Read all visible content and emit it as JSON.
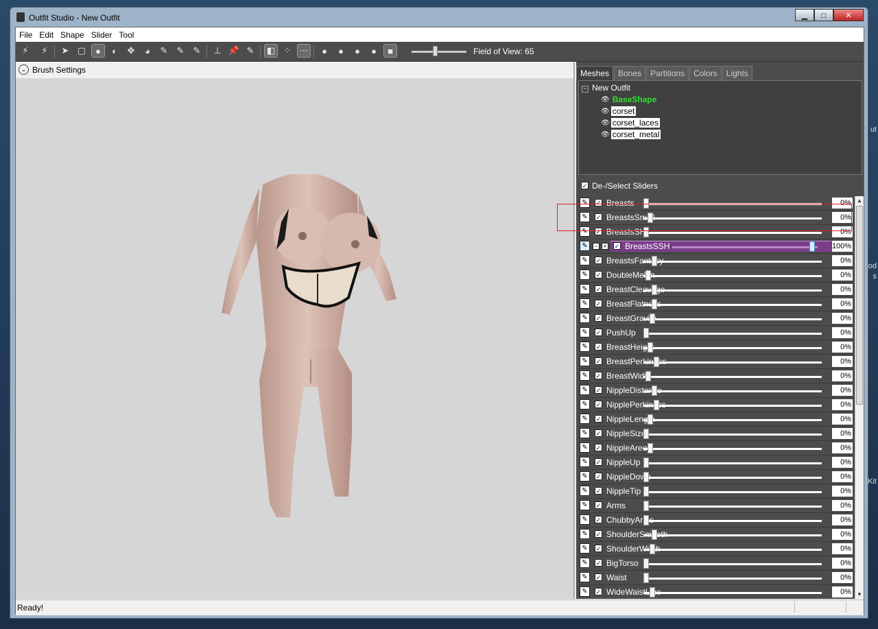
{
  "window": {
    "title": "Outfit Studio - New Outfit",
    "btn_min": "▁",
    "btn_max": "□",
    "btn_close": "✕"
  },
  "menu": [
    "File",
    "Edit",
    "Shape",
    "Slider",
    "Tool"
  ],
  "toolbar": {
    "fov_label": "Field of View: 65",
    "fov_value": 65
  },
  "left": {
    "brush_settings": "Brush Settings"
  },
  "tabs": [
    {
      "label": "Meshes",
      "active": true
    },
    {
      "label": "Bones",
      "active": false
    },
    {
      "label": "Partitions",
      "active": false
    },
    {
      "label": "Colors",
      "active": false
    },
    {
      "label": "Lights",
      "active": false
    }
  ],
  "tree": {
    "root": "New Outfit",
    "meshes": [
      {
        "name": "BaseShape",
        "selected": true
      },
      {
        "name": "corset",
        "selected": false
      },
      {
        "name": "corset_laces",
        "selected": false
      },
      {
        "name": "corset_metal",
        "selected": false
      }
    ]
  },
  "deselect_label": "De-/Select Sliders",
  "sliders": [
    {
      "name": "Breasts",
      "value": 0,
      "text": "0%"
    },
    {
      "name": "BreastsSmall",
      "value": 0,
      "text": "0%"
    },
    {
      "name": "BreastsSH",
      "value": 0,
      "text": "0%"
    },
    {
      "name": "BreastsSSH",
      "value": 100,
      "text": "100%",
      "editing": true
    },
    {
      "name": "BreastsFantasy",
      "value": 0,
      "text": "0%"
    },
    {
      "name": "DoubleMelon",
      "value": 0,
      "text": "0%"
    },
    {
      "name": "BreastCleavage",
      "value": 0,
      "text": "0%"
    },
    {
      "name": "BreastFlatness",
      "value": 0,
      "text": "0%"
    },
    {
      "name": "BreastGravity",
      "value": 0,
      "text": "0%"
    },
    {
      "name": "PushUp",
      "value": 0,
      "text": "0%"
    },
    {
      "name": "BreastHeight",
      "value": 0,
      "text": "0%"
    },
    {
      "name": "BreastPerkiness",
      "value": 0,
      "text": "0%"
    },
    {
      "name": "BreastWidth",
      "value": 0,
      "text": "0%"
    },
    {
      "name": "NippleDistance",
      "value": 0,
      "text": "0%"
    },
    {
      "name": "NipplePerkiness",
      "value": 0,
      "text": "0%"
    },
    {
      "name": "NippleLength",
      "value": 0,
      "text": "0%"
    },
    {
      "name": "NippleSize",
      "value": 0,
      "text": "0%"
    },
    {
      "name": "NippleAreola",
      "value": 0,
      "text": "0%"
    },
    {
      "name": "NippleUp",
      "value": 0,
      "text": "0%"
    },
    {
      "name": "NippleDown",
      "value": 0,
      "text": "0%"
    },
    {
      "name": "NippleTip",
      "value": 0,
      "text": "0%"
    },
    {
      "name": "Arms",
      "value": 0,
      "text": "0%"
    },
    {
      "name": "ChubbyArms",
      "value": 0,
      "text": "0%"
    },
    {
      "name": "ShoulderSmooth",
      "value": 0,
      "text": "0%"
    },
    {
      "name": "ShoulderWidth",
      "value": 0,
      "text": "0%"
    },
    {
      "name": "BigTorso",
      "value": 0,
      "text": "0%"
    },
    {
      "name": "Waist",
      "value": 0,
      "text": "0%"
    },
    {
      "name": "WideWaistLine",
      "value": 0,
      "text": "0%"
    }
  ],
  "status": "Ready!",
  "desktop_fragments": [
    "ut",
    "od",
    "s",
    "Kit"
  ]
}
